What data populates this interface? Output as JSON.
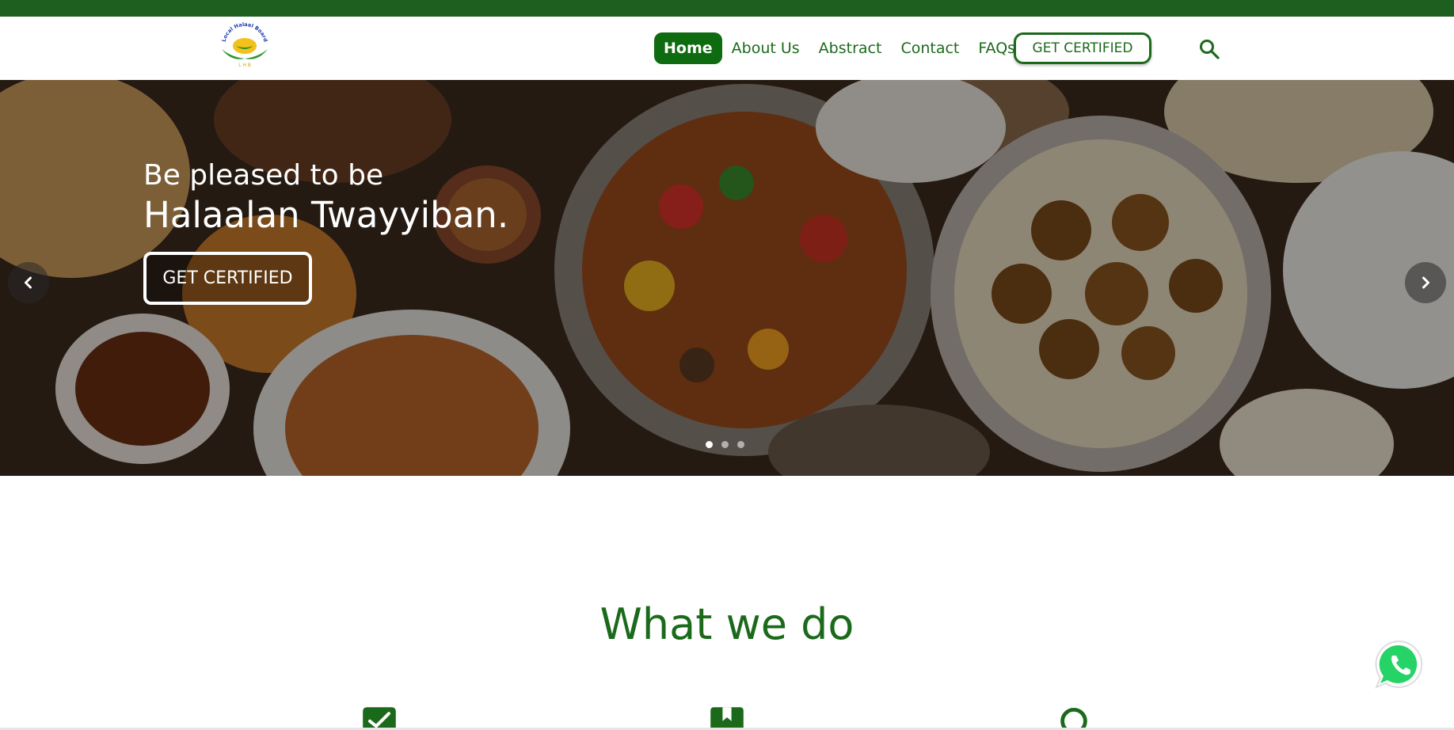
{
  "brand": {
    "logo_alt": "Local Halaal Board logo",
    "logo_text_arc": "Local Halaal Board",
    "logo_letters": "L H B",
    "accent": "#1b6a1b",
    "dark_accent": "#1e5e1e"
  },
  "nav": {
    "items": [
      {
        "label": "Home",
        "active": true
      },
      {
        "label": "About Us"
      },
      {
        "label": "Abstract"
      },
      {
        "label": "Contact"
      },
      {
        "label": "FAQs"
      }
    ],
    "cta_label": "GET CERTIFIED",
    "search_icon": "search-icon"
  },
  "hero": {
    "line1": "Be pleased to be",
    "line2": "Halaalan Twayyiban.",
    "cta_label": "GET CERTIFIED",
    "prev_icon": "chevron-left-icon",
    "next_icon": "chevron-right-icon",
    "slides_count": 3,
    "active_slide": 1
  },
  "section": {
    "title": "What we do",
    "feature_icons": [
      "checkbox-icon",
      "bookmark-icon",
      "search-icon"
    ]
  },
  "whatsapp": {
    "icon": "whatsapp-icon"
  }
}
